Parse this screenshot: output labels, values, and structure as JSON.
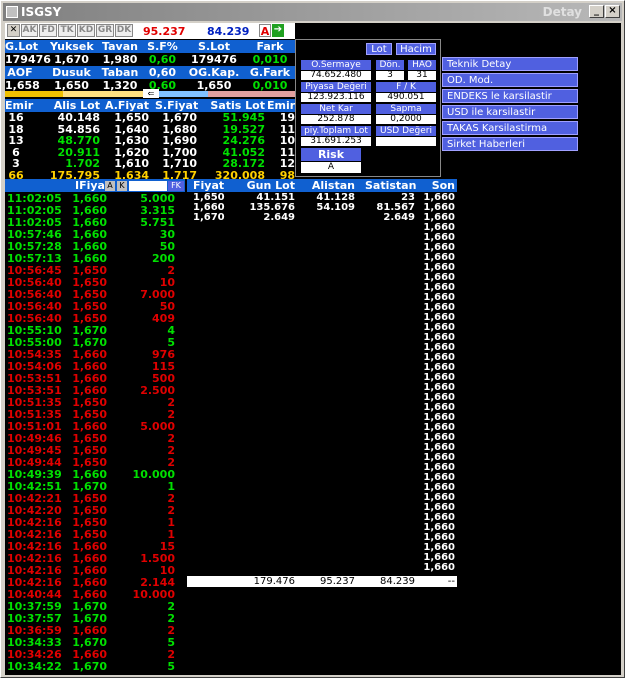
{
  "window": {
    "title": "ISGSY",
    "detail": "Detay"
  },
  "toolbar": {
    "buttons": [
      "AK",
      "FD",
      "TK",
      "KD",
      "GR",
      "DK"
    ],
    "price1": "95.237",
    "price2": "84.239",
    "a_label": "A"
  },
  "summary": {
    "row1_headers": [
      "G.Lot",
      "Yuksek",
      "Tavan",
      "S.F%",
      "S.Lot",
      "Fark"
    ],
    "row1_values": [
      "179476",
      "1,670",
      "1,980",
      "0,60",
      "179476",
      "0,010"
    ],
    "row2_headers": [
      "AOF",
      "Dusuk",
      "Taban",
      "0,60",
      "OG.Kap.",
      "G.Fark"
    ],
    "row2_values": [
      "1,658",
      "1,650",
      "1,320",
      "0,60",
      "1,650",
      "0,010"
    ]
  },
  "book": {
    "headers": [
      "Emir",
      "Alis Lot",
      "A.Fiyat",
      "S.Fiyat",
      "Satis Lot",
      "Emir"
    ],
    "rows": [
      [
        "16",
        "40.148",
        "1,650",
        "1,670",
        "51.945",
        "19"
      ],
      [
        "18",
        "54.856",
        "1,640",
        "1,680",
        "19.527",
        "11"
      ],
      [
        "13",
        "48.770",
        "1,630",
        "1,690",
        "24.276",
        "10"
      ],
      [
        "6",
        "20.911",
        "1,620",
        "1,700",
        "41.052",
        "11"
      ],
      [
        "3",
        "1.702",
        "1,610",
        "1,710",
        "28.172",
        "12"
      ],
      [
        "66",
        "175.795",
        "1,634",
        "1,717",
        "320.008",
        "98"
      ]
    ]
  },
  "info_panel": {
    "tabs": [
      "Lot",
      "Hacim"
    ],
    "fields": [
      {
        "label": "Ö.Sermaye",
        "value": "74.652.480"
      },
      {
        "label": "Dön.",
        "value": "3"
      },
      {
        "label": "HAO",
        "value": "31"
      },
      {
        "label": "Piyasa Değeri",
        "value": "123.923.116"
      },
      {
        "label": "F / K",
        "value": "490.051"
      },
      {
        "label": "Net Kar",
        "value": "252.878"
      },
      {
        "label": "Sapma",
        "value": "0,2000"
      },
      {
        "label": "piy.Toplam Lot",
        "value": "31.691.253"
      },
      {
        "label": "USD Değeri",
        "value": ""
      },
      {
        "label": "Risk Kodu",
        "value": "A"
      }
    ]
  },
  "menu": [
    "Teknik Detay",
    "OD. Mod.",
    "ENDEKS le karsilastir",
    "USD ile karsilastir",
    "TAKAS Karsilastirma",
    "Sirket Haberleri"
  ],
  "trades": {
    "headers": [
      "IFiyat",
      "A",
      "K",
      "",
      "FK"
    ],
    "rows": [
      [
        "11:02:05",
        "1,660",
        "5.000",
        "g"
      ],
      [
        "11:02:05",
        "1,660",
        "3.315",
        "g"
      ],
      [
        "11:02:05",
        "1,660",
        "5.751",
        "g"
      ],
      [
        "10:57:46",
        "1,660",
        "30",
        "g"
      ],
      [
        "10:57:28",
        "1,660",
        "50",
        "g"
      ],
      [
        "10:57:13",
        "1,660",
        "200",
        "g"
      ],
      [
        "10:56:45",
        "1,650",
        "2",
        "r"
      ],
      [
        "10:56:40",
        "1,650",
        "10",
        "r"
      ],
      [
        "10:56:40",
        "1,650",
        "7.000",
        "r"
      ],
      [
        "10:56:40",
        "1,650",
        "50",
        "r"
      ],
      [
        "10:56:40",
        "1,650",
        "409",
        "r"
      ],
      [
        "10:55:10",
        "1,670",
        "4",
        "g"
      ],
      [
        "10:55:00",
        "1,670",
        "5",
        "g"
      ],
      [
        "10:54:35",
        "1,660",
        "976",
        "r"
      ],
      [
        "10:54:06",
        "1,660",
        "115",
        "r"
      ],
      [
        "10:53:51",
        "1,660",
        "500",
        "r"
      ],
      [
        "10:53:51",
        "1,660",
        "2.500",
        "r"
      ],
      [
        "10:51:35",
        "1,650",
        "2",
        "r"
      ],
      [
        "10:51:35",
        "1,650",
        "2",
        "r"
      ],
      [
        "10:51:01",
        "1,660",
        "5.000",
        "r"
      ],
      [
        "10:49:46",
        "1,650",
        "2",
        "r"
      ],
      [
        "10:49:45",
        "1,650",
        "2",
        "r"
      ],
      [
        "10:49:44",
        "1,650",
        "2",
        "r"
      ],
      [
        "10:49:39",
        "1,660",
        "10.000",
        "g"
      ],
      [
        "10:42:51",
        "1,670",
        "1",
        "g"
      ],
      [
        "10:42:21",
        "1,650",
        "2",
        "r"
      ],
      [
        "10:42:20",
        "1,650",
        "2",
        "r"
      ],
      [
        "10:42:16",
        "1,650",
        "1",
        "r"
      ],
      [
        "10:42:16",
        "1,650",
        "1",
        "r"
      ],
      [
        "10:42:16",
        "1,660",
        "15",
        "r"
      ],
      [
        "10:42:16",
        "1,660",
        "1.500",
        "r"
      ],
      [
        "10:42:16",
        "1,660",
        "10",
        "r"
      ],
      [
        "10:42:16",
        "1,660",
        "2.144",
        "r"
      ],
      [
        "10:40:44",
        "1,660",
        "10.000",
        "r"
      ],
      [
        "10:37:59",
        "1,670",
        "2",
        "g"
      ],
      [
        "10:37:57",
        "1,670",
        "2",
        "g"
      ],
      [
        "10:36:59",
        "1,660",
        "2",
        "r"
      ],
      [
        "10:34:33",
        "1,670",
        "5",
        "g"
      ],
      [
        "10:34:26",
        "1,660",
        "2",
        "r"
      ],
      [
        "10:34:22",
        "1,670",
        "5",
        "g"
      ]
    ]
  },
  "depth": {
    "headers": [
      "Fiyat",
      "Gun Lot",
      "Alistan",
      "Satistan",
      "Son"
    ],
    "rows": [
      [
        "1,650",
        "41.151",
        "41.128",
        "23",
        "1,660"
      ],
      [
        "1,660",
        "135.676",
        "54.109",
        "81.567",
        "1,660"
      ],
      [
        "1,670",
        "2.649",
        "",
        "2.649",
        "1,660"
      ]
    ],
    "son_rest": "1,660",
    "total": [
      "179.476",
      "95.237",
      "84.239",
      "--"
    ]
  }
}
